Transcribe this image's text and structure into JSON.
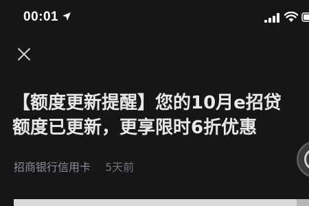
{
  "status_bar": {
    "time": "00:01",
    "icons": [
      "location-arrow-icon",
      "cellular-signal-icon",
      "wifi-icon",
      "battery-icon"
    ]
  },
  "toolbar": {
    "close_icon": "close-icon"
  },
  "article": {
    "title_line1": "【额度更新提醒】您的10月e招贷",
    "title_line2": "额度已更新，更享限时6折优惠",
    "source": "招商银行信用卡",
    "time": "5天前"
  },
  "colors": {
    "background": "#161616",
    "title": "#e8e8e8",
    "meta": "#8a8f99"
  }
}
